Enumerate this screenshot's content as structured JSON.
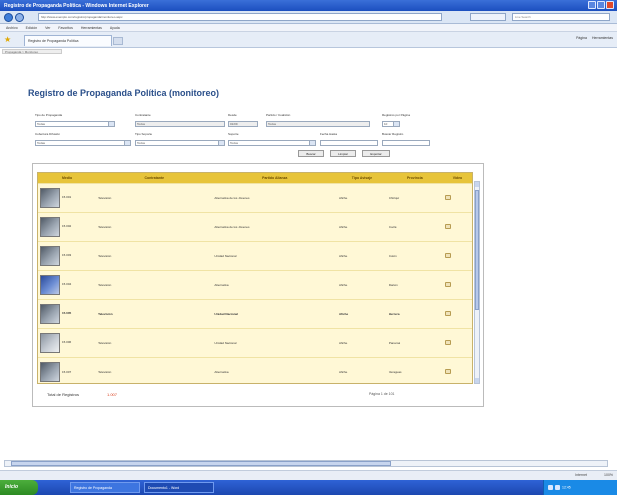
{
  "window": {
    "title": "Registro de Propaganda Política - Windows Internet Explorer"
  },
  "address": {
    "url": "http://www.exemplo.com/registro/propaganda/monitoreo.aspx",
    "search_placeholder": "Live Search"
  },
  "menu": [
    "Archivo",
    "Edición",
    "Ver",
    "Favoritos",
    "Herramientas",
    "Ayuda"
  ],
  "tab": {
    "label": "Registro de Propaganda Política"
  },
  "tools": [
    "Página",
    "Herramientas"
  ],
  "breadcrumb": "Propaganda > Monitoreo",
  "page": {
    "title": "Registro de Propaganda Política (monitoreo)"
  },
  "filters": {
    "tipo_propaganda": {
      "label": "Tipo de Propaganda",
      "value": "Todas"
    },
    "contratante": {
      "label": "Contratante",
      "value": "Todos"
    },
    "desde": {
      "label": "Desde",
      "value": "01/09"
    },
    "partido": {
      "label": "Partido / Coalición",
      "value": "Todos"
    },
    "registros_pagina": {
      "label": "Registros por Página",
      "value": "10"
    },
    "cobertura": {
      "label": "Cobertura Difusión",
      "value": "Todas"
    },
    "tipo_soporte": {
      "label": "Tipo Soporte",
      "value": "Todos"
    },
    "soporte": {
      "label": "Soporte",
      "value": "Todos"
    },
    "fecha_hasta": {
      "label": "Fecha Hasta",
      "value": ""
    },
    "buscar_id": {
      "label": "Buscar Registro",
      "value": ""
    },
    "btn_search": "Buscar",
    "btn_clear": "Limpiar",
    "btn_export": "Exportar"
  },
  "table": {
    "headers": [
      "Medio",
      "Contratante",
      "Partido Alianza",
      "Tipo Avisaje",
      "Provincia",
      "Video"
    ],
    "rows": [
      {
        "id": "15.001",
        "medio": "Televisión",
        "contratante": "",
        "partido": "Alternativa de los Jóvenes",
        "tipo": "Afiche",
        "provincia": "Chiriquí",
        "thumb": "dark"
      },
      {
        "id": "15.002",
        "medio": "Televisión",
        "contratante": "",
        "partido": "Alternativa de los Jóvenes",
        "tipo": "Afiche",
        "provincia": "Coclé",
        "thumb": "dark"
      },
      {
        "id": "15.003",
        "medio": "Televisión",
        "contratante": "",
        "partido": "Unidad Nacional",
        "tipo": "Afiche",
        "provincia": "Colón",
        "thumb": "dark"
      },
      {
        "id": "15.004",
        "medio": "Televisión",
        "contratante": "",
        "partido": "Alternativa",
        "tipo": "Afiche",
        "provincia": "Darién",
        "thumb": "blue"
      },
      {
        "id": "15.005",
        "medio": "Televisión",
        "contratante": "",
        "partido": "Unidad Nacional",
        "tipo": "Afiche",
        "provincia": "Herrera",
        "thumb": "dark",
        "bold": true
      },
      {
        "id": "15.006",
        "medio": "Televisión",
        "contratante": "",
        "partido": "Unidad Nacional",
        "tipo": "Afiche",
        "provincia": "Panamá",
        "thumb": "light"
      },
      {
        "id": "15.007",
        "medio": "Televisión",
        "contratante": "",
        "partido": "Alternativa",
        "tipo": "Afiche",
        "provincia": "Veraguas",
        "thumb": "dark"
      }
    ]
  },
  "footer": {
    "total_label": "Total de Registros",
    "total_value": "1.007",
    "pager": "Página 1 de 101"
  },
  "status": {
    "zone": "Internet",
    "zoom": "100%"
  },
  "taskbar": {
    "start": "Inicio",
    "tasks": [
      "Registro de Propaganda",
      "Documento1 - Word"
    ],
    "clock": "12:45"
  },
  "colors": {
    "accent": "#e7c43a",
    "title": "#2a4f8a",
    "total": "#d9401f"
  }
}
